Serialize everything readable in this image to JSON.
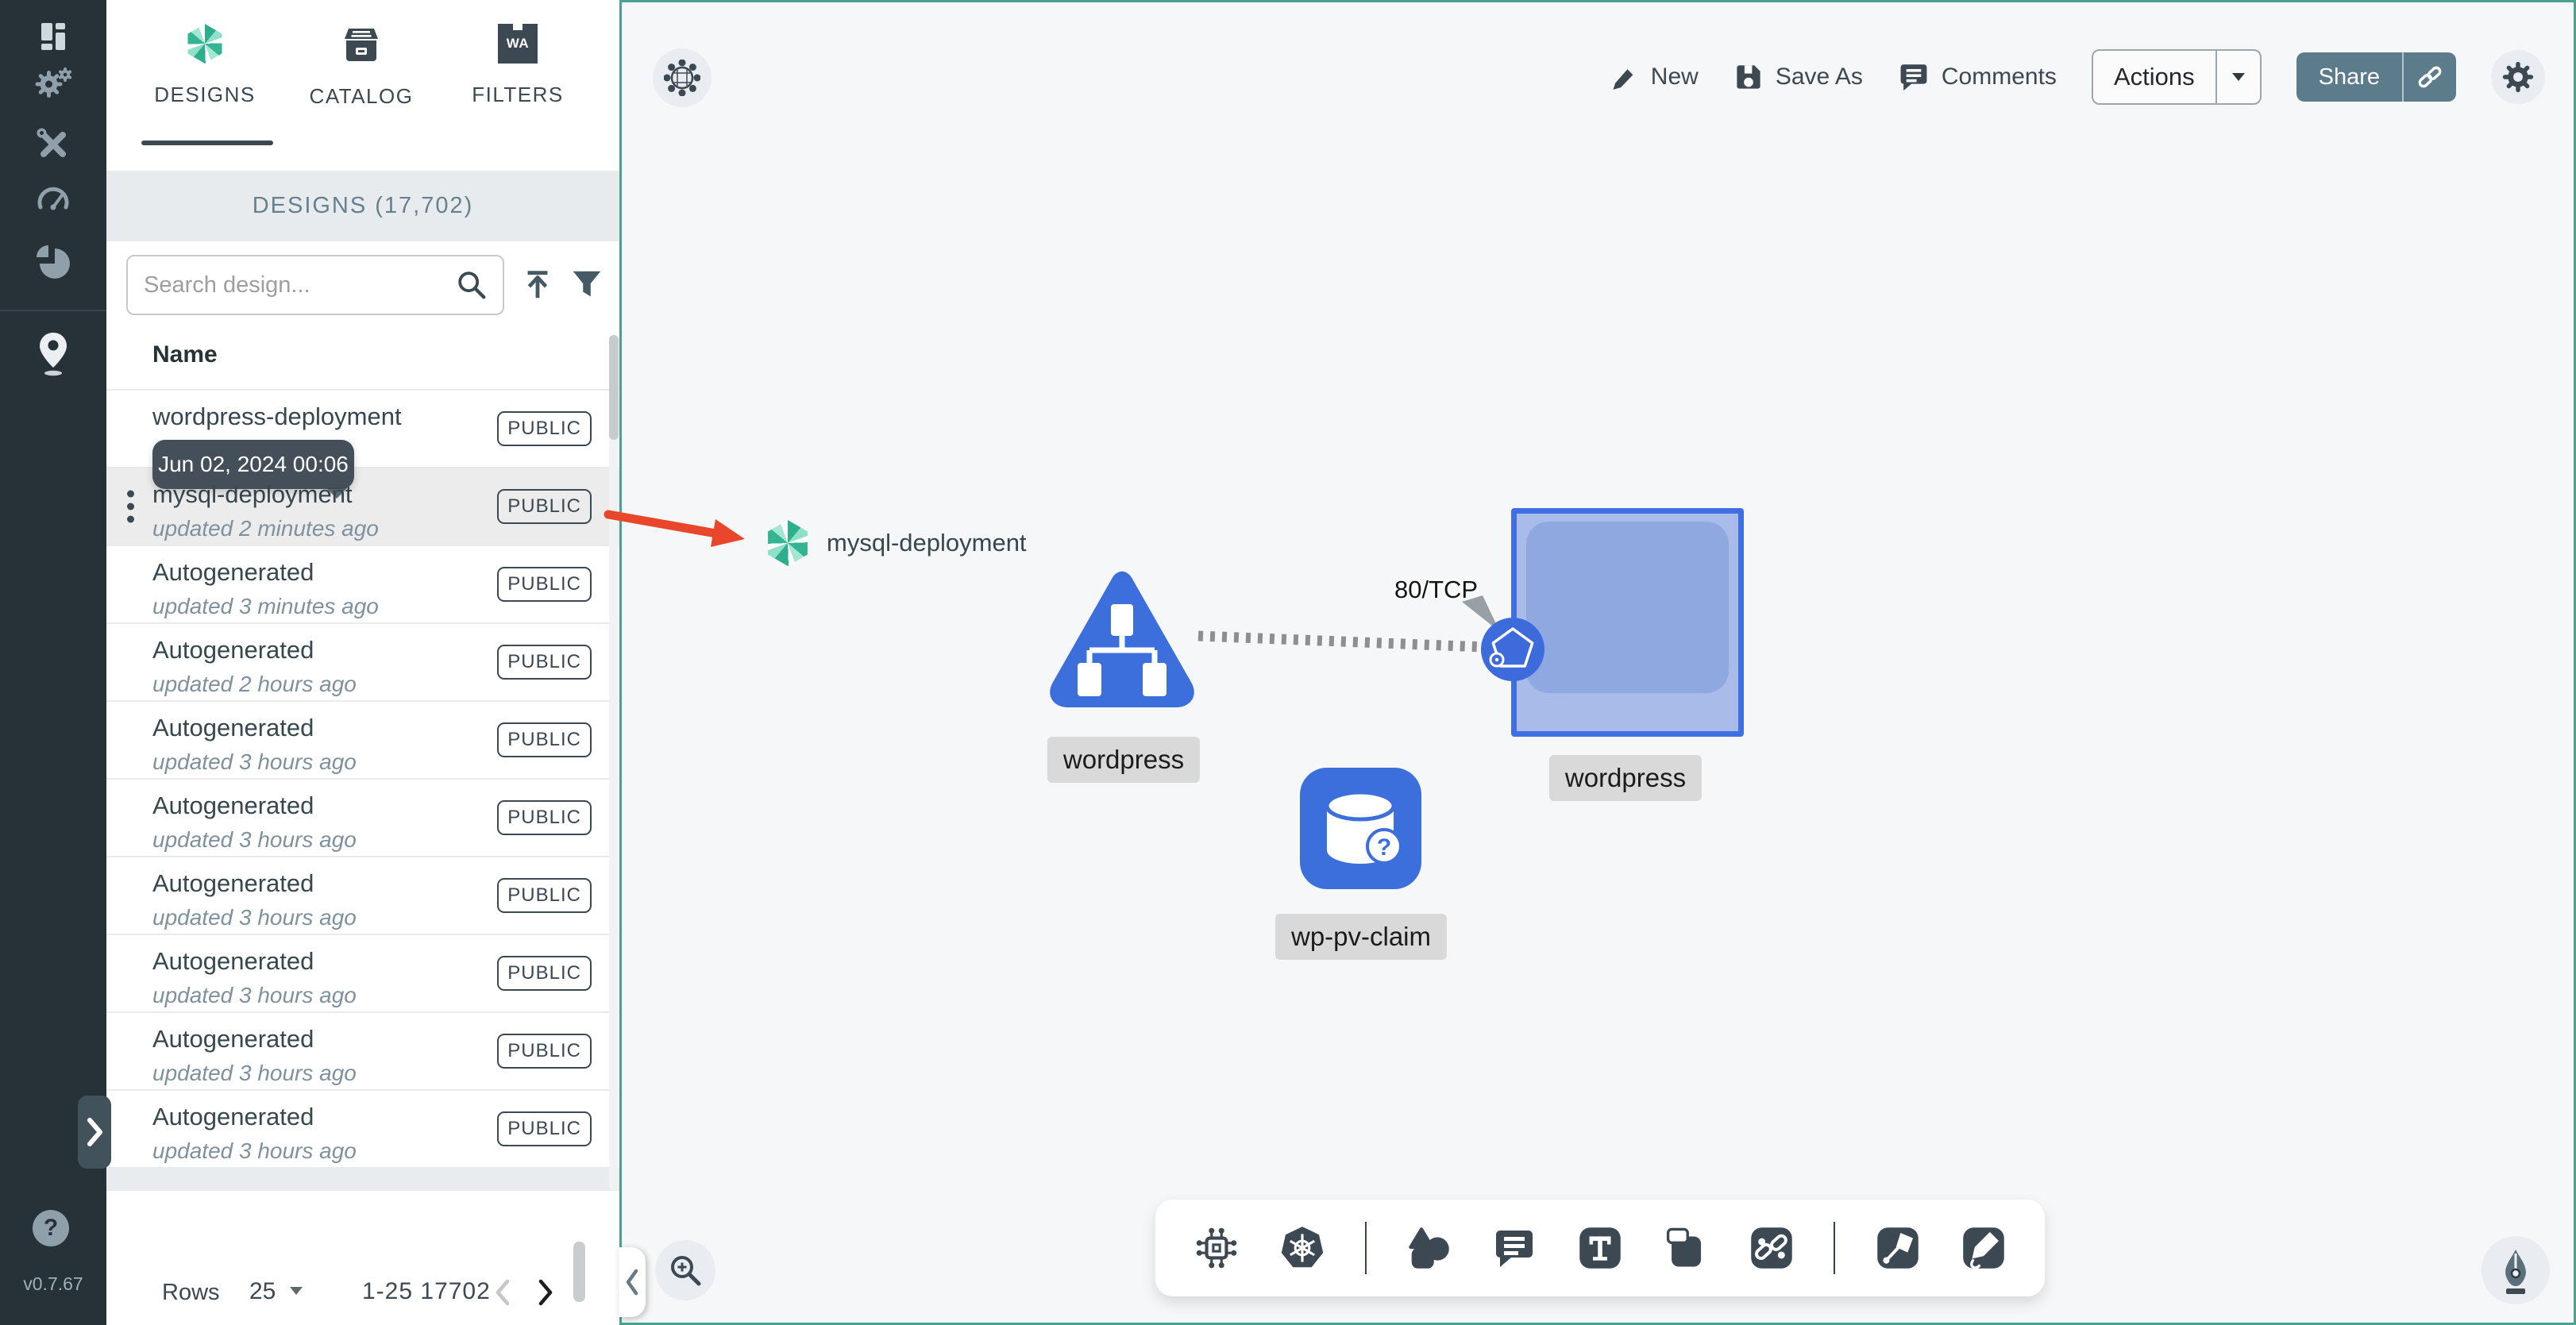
{
  "app": {
    "version": "v0.7.67"
  },
  "sidebar": {
    "icon_names": [
      "dashboard-icon",
      "lifecycle-settings-icon",
      "toolbox-icon",
      "performance-icon",
      "extensions-icon",
      "meshmap-pin-icon"
    ],
    "help_glyph": "?",
    "collapse_tooltip_chevron": "›"
  },
  "panel": {
    "tabs": [
      {
        "label": "DESIGNS",
        "active": true
      },
      {
        "label": "CATALOG",
        "active": false
      },
      {
        "label": "FILTERS",
        "active": false,
        "icon_text": "WA"
      }
    ],
    "count_header": "DESIGNS (17,702)",
    "search_placeholder": "Search design...",
    "column_header": "Name",
    "tooltip": "Jun 02, 2024 00:06",
    "rows": [
      {
        "name": "wordpress-deployment",
        "subtitle": "",
        "badge": "PUBLIC",
        "highlighted": false
      },
      {
        "name": "mysql-deployment",
        "subtitle": "updated 2 minutes ago",
        "badge": "PUBLIC",
        "highlighted": true
      },
      {
        "name": "Autogenerated",
        "subtitle": "updated 3 minutes ago",
        "badge": "PUBLIC",
        "highlighted": false
      },
      {
        "name": "Autogenerated",
        "subtitle": "updated 2 hours ago",
        "badge": "PUBLIC",
        "highlighted": false
      },
      {
        "name": "Autogenerated",
        "subtitle": "updated 3 hours ago",
        "badge": "PUBLIC",
        "highlighted": false
      },
      {
        "name": "Autogenerated",
        "subtitle": "updated 3 hours ago",
        "badge": "PUBLIC",
        "highlighted": false
      },
      {
        "name": "Autogenerated",
        "subtitle": "updated 3 hours ago",
        "badge": "PUBLIC",
        "highlighted": false
      },
      {
        "name": "Autogenerated",
        "subtitle": "updated 3 hours ago",
        "badge": "PUBLIC",
        "highlighted": false
      },
      {
        "name": "Autogenerated",
        "subtitle": "updated 3 hours ago",
        "badge": "PUBLIC",
        "highlighted": false
      },
      {
        "name": "Autogenerated",
        "subtitle": "updated 3 hours ago",
        "badge": "PUBLIC",
        "highlighted": false
      }
    ],
    "pagination": {
      "rows_label": "Rows",
      "page_size": "25",
      "range": "1-25 17702"
    }
  },
  "toolbar": {
    "new": "New",
    "save_as": "Save As",
    "comments": "Comments",
    "actions": "Actions",
    "share": "Share"
  },
  "canvas": {
    "design_item_label": "mysql-deployment",
    "edge_label": "80/TCP",
    "node_labels": [
      "wordpress",
      "wordpress",
      "wp-pv-claim"
    ],
    "unknown_glyph": "?"
  },
  "colors": {
    "accent_teal": "#4BA18F",
    "node_blue": "#3C6FDC",
    "square_fill": "#A9BCE9",
    "square_inner": "#8FA9E0",
    "arrow_red": "#E8472B",
    "sidebar_bg": "#263238",
    "slate": "#3C4852",
    "share_button": "#5D7C8B",
    "count_bar_bg": "#E8EBED"
  }
}
